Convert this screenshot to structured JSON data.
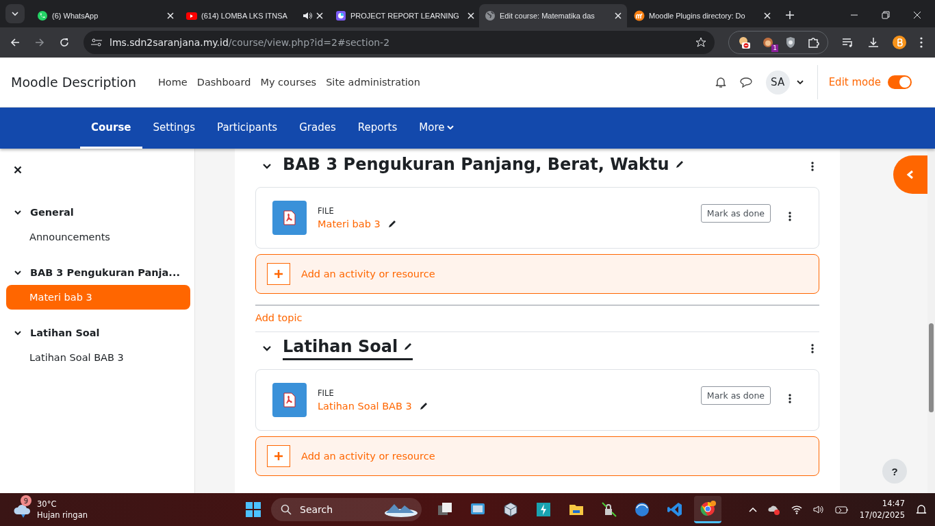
{
  "browser": {
    "tabs": [
      {
        "title": "(6) WhatsApp",
        "audio": false,
        "selected": false
      },
      {
        "title": "(614) LOMBA LKS ITNSA",
        "audio": true,
        "selected": false
      },
      {
        "title": "PROJECT REPORT LEARNING",
        "audio": false,
        "selected": false
      },
      {
        "title": "Edit course: Matematika das",
        "audio": false,
        "selected": true
      },
      {
        "title": "Moodle Plugins directory: Do",
        "audio": false,
        "selected": false
      }
    ],
    "address": {
      "host": "lms.sdn2saranjana.my.id",
      "path": "/course/view.php?id=2#section-2"
    },
    "extension_badge": "1"
  },
  "header": {
    "site_name": "Moodle Description",
    "nav": [
      "Home",
      "Dashboard",
      "My courses",
      "Site administration"
    ],
    "user_initials": "SA",
    "edit_mode": {
      "label": "Edit mode",
      "on": true
    }
  },
  "secondary_nav": [
    {
      "label": "Course",
      "selected": true,
      "dropdown": false
    },
    {
      "label": "Settings",
      "selected": false,
      "dropdown": false
    },
    {
      "label": "Participants",
      "selected": false,
      "dropdown": false
    },
    {
      "label": "Grades",
      "selected": false,
      "dropdown": false
    },
    {
      "label": "Reports",
      "selected": false,
      "dropdown": false
    },
    {
      "label": "More",
      "selected": false,
      "dropdown": true
    }
  ],
  "drawer": {
    "sections": [
      {
        "title": "General",
        "expanded": true,
        "children": [
          {
            "label": "Announcements",
            "selected": false
          }
        ]
      },
      {
        "title": "BAB 3 Pengukuran Panja...",
        "expanded": true,
        "children": [
          {
            "label": "Materi bab 3",
            "selected": true
          }
        ]
      },
      {
        "title": "Latihan Soal",
        "expanded": true,
        "children": [
          {
            "label": "Latihan Soal BAB 3",
            "selected": false
          }
        ]
      }
    ]
  },
  "content": [
    {
      "kind": "section",
      "title": "BAB 3 Pengukuran Panjang, Berat, Waktu",
      "expanded": true,
      "highlighted": false,
      "activities": [
        {
          "type": "FILE",
          "name": "Materi bab 3",
          "completion": "Mark as done"
        }
      ],
      "add_label": "Add an activity or resource"
    },
    {
      "kind": "add_topic",
      "label": "Add topic"
    },
    {
      "kind": "section",
      "title": "Latihan Soal",
      "expanded": true,
      "highlighted": true,
      "activities": [
        {
          "type": "FILE",
          "name": "Latihan Soal BAB 3",
          "completion": "Mark as done"
        }
      ],
      "add_label": "Add an activity or resource"
    }
  ],
  "help_label": "?",
  "taskbar": {
    "weather": {
      "badge": "9",
      "temperature": "30°C",
      "description": "Hujan ringan"
    },
    "search": "Search",
    "time": "14:47",
    "date": "17/02/2025"
  }
}
